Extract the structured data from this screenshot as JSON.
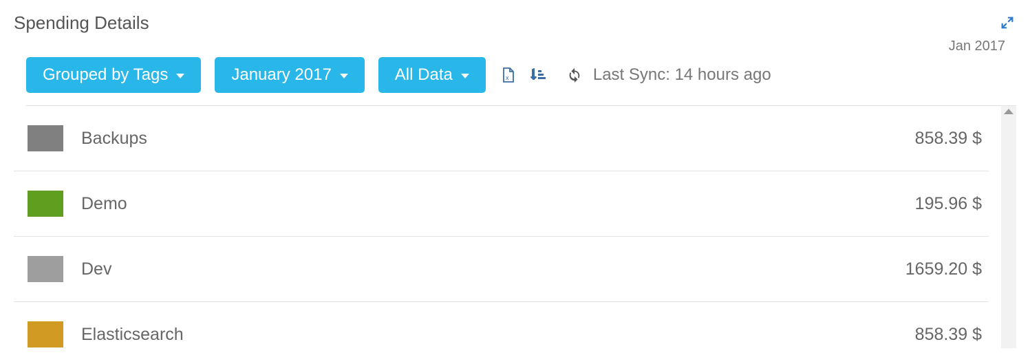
{
  "panel": {
    "title": "Spending Details",
    "date_label": "Jan 2017"
  },
  "toolbar": {
    "group_label": "Grouped by Tags",
    "period_label": "January 2017",
    "data_label": "All Data",
    "sync_text": "Last Sync: 14 hours ago"
  },
  "rows": [
    {
      "color": "#808080",
      "label": "Backups",
      "amount": "858.39 $"
    },
    {
      "color": "#5f9e1f",
      "label": "Demo",
      "amount": "195.96 $"
    },
    {
      "color": "#9e9e9e",
      "label": "Dev",
      "amount": "1659.20 $"
    },
    {
      "color": "#d19a22",
      "label": "Elasticsearch",
      "amount": "858.39 $"
    }
  ]
}
